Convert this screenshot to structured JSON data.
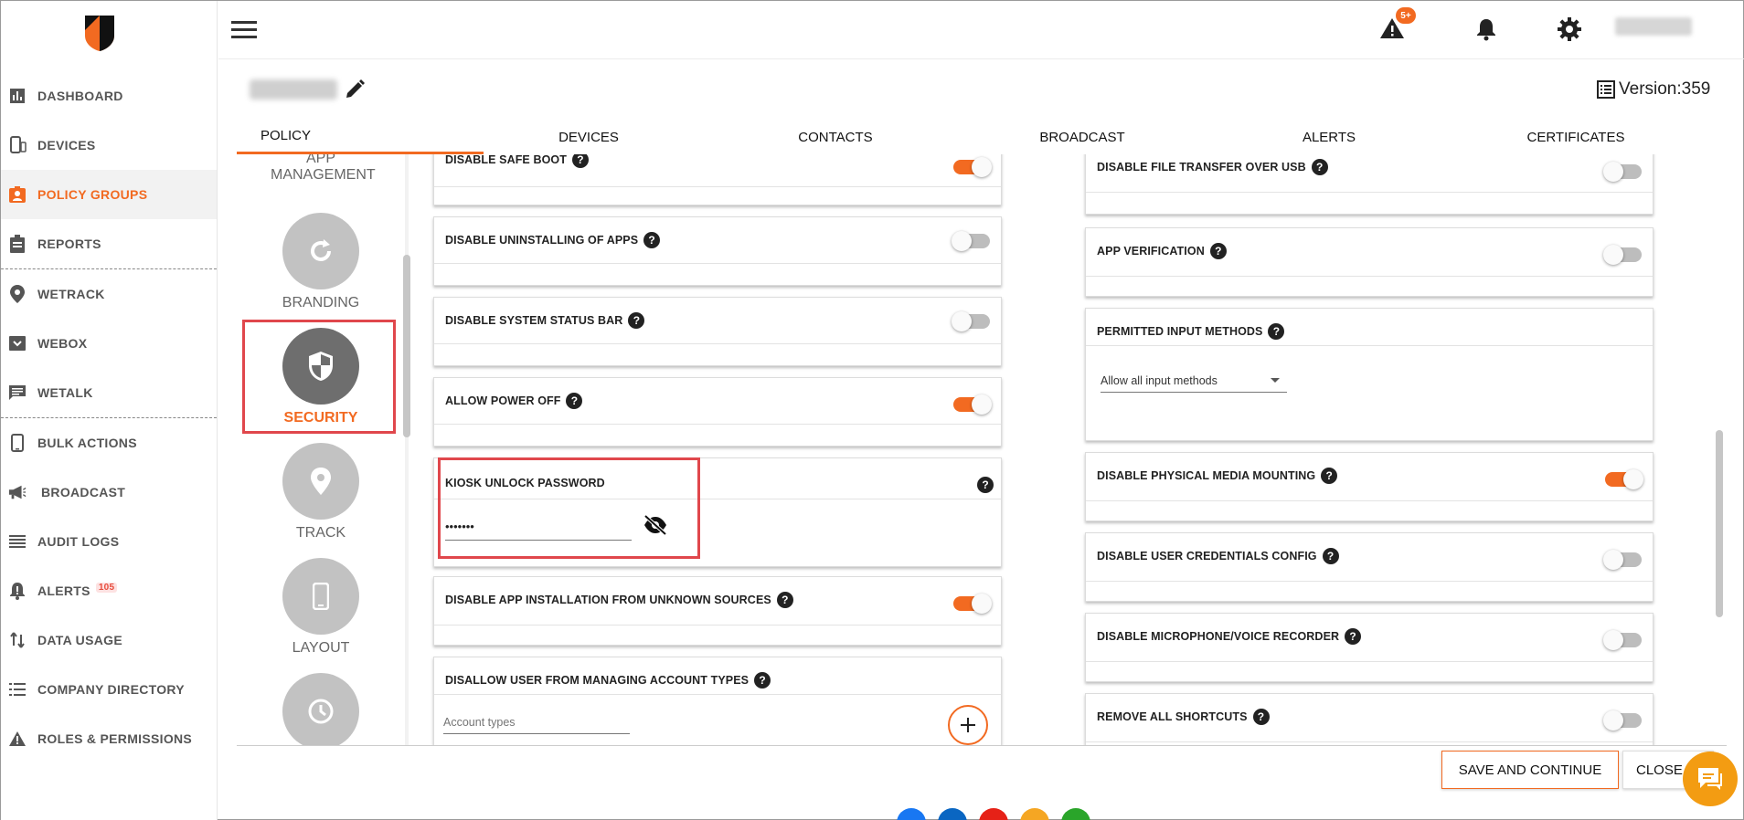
{
  "sidebar": {
    "items": [
      {
        "label": "DASHBOARD",
        "icon": "bar-chart-icon"
      },
      {
        "label": "DEVICES",
        "icon": "devices-icon"
      },
      {
        "label": "POLICY GROUPS",
        "icon": "policy-groups-icon"
      },
      {
        "label": "REPORTS",
        "icon": "clipboard-icon"
      },
      {
        "label": "WETRACK",
        "icon": "location-pin-icon"
      },
      {
        "label": "WEBOX",
        "icon": "inbox-icon"
      },
      {
        "label": "WETALK",
        "icon": "chat-icon"
      },
      {
        "label": "BULK ACTIONS",
        "icon": "phone-icon"
      },
      {
        "label": "BROADCAST",
        "icon": "megaphone-icon"
      },
      {
        "label": "AUDIT LOGS",
        "icon": "list-icon"
      },
      {
        "label": "ALERTS",
        "icon": "alert-bell-icon",
        "badge": "105"
      },
      {
        "label": "DATA USAGE",
        "icon": "transfer-arrows-icon"
      },
      {
        "label": "COMPANY DIRECTORY",
        "icon": "directory-list-icon"
      },
      {
        "label": "ROLES & PERMISSIONS",
        "icon": "warning-icon"
      }
    ],
    "active_item": "POLICY GROUPS"
  },
  "topbar": {
    "alert_count": "5+"
  },
  "header": {
    "version": "Version:359"
  },
  "tabs": [
    "POLICY",
    "DEVICES",
    "CONTACTS",
    "BROADCAST",
    "ALERTS",
    "CERTIFICATES"
  ],
  "active_tab": "POLICY",
  "categories": [
    {
      "label": "APP MANAGEMENT",
      "icon": "apps-icon"
    },
    {
      "label": "BRANDING",
      "icon": "refresh-icon"
    },
    {
      "label": "SECURITY",
      "icon": "shield-icon",
      "active": true
    },
    {
      "label": "TRACK",
      "icon": "location-pin-icon"
    },
    {
      "label": "LAYOUT",
      "icon": "phone-icon"
    },
    {
      "label": "",
      "icon": "clock-icon"
    }
  ],
  "left_settings": {
    "safe_boot": {
      "label": "DISABLE SAFE BOOT",
      "on": true
    },
    "uninstall_apps": {
      "label": "DISABLE UNINSTALLING OF APPS",
      "on": false
    },
    "status_bar": {
      "label": "DISABLE SYSTEM STATUS BAR",
      "on": false
    },
    "power_off": {
      "label": "ALLOW POWER OFF",
      "on": true
    },
    "kiosk_password": {
      "label": "KIOSK UNLOCK PASSWORD",
      "value": "•••••••"
    },
    "unknown_sources": {
      "label": "DISABLE APP INSTALLATION FROM UNKNOWN SOURCES",
      "on": true
    },
    "account_types": {
      "label": "DISALLOW USER FROM MANAGING ACCOUNT TYPES",
      "placeholder": "Account types"
    }
  },
  "right_settings": {
    "file_transfer": {
      "label": "DISABLE FILE TRANSFER OVER USB",
      "on": false
    },
    "app_verification": {
      "label": "APP VERIFICATION",
      "on": false
    },
    "input_methods": {
      "label": "PERMITTED INPUT METHODS",
      "selected": "Allow all input methods"
    },
    "media_mounting": {
      "label": "DISABLE PHYSICAL MEDIA MOUNTING",
      "on": true
    },
    "credentials": {
      "label": "DISABLE USER CREDENTIALS CONFIG",
      "on": false
    },
    "microphone": {
      "label": "DISABLE MICROPHONE/VOICE RECORDER",
      "on": false
    },
    "shortcuts": {
      "label": "REMOVE ALL SHORTCUTS",
      "on": false
    }
  },
  "footer": {
    "save_label": "SAVE AND CONTINUE",
    "close_label": "CLOSE"
  },
  "colors": {
    "accent": "#f26a21",
    "highlight": "#e0474c",
    "toggle_off": "#bdbdbd"
  }
}
